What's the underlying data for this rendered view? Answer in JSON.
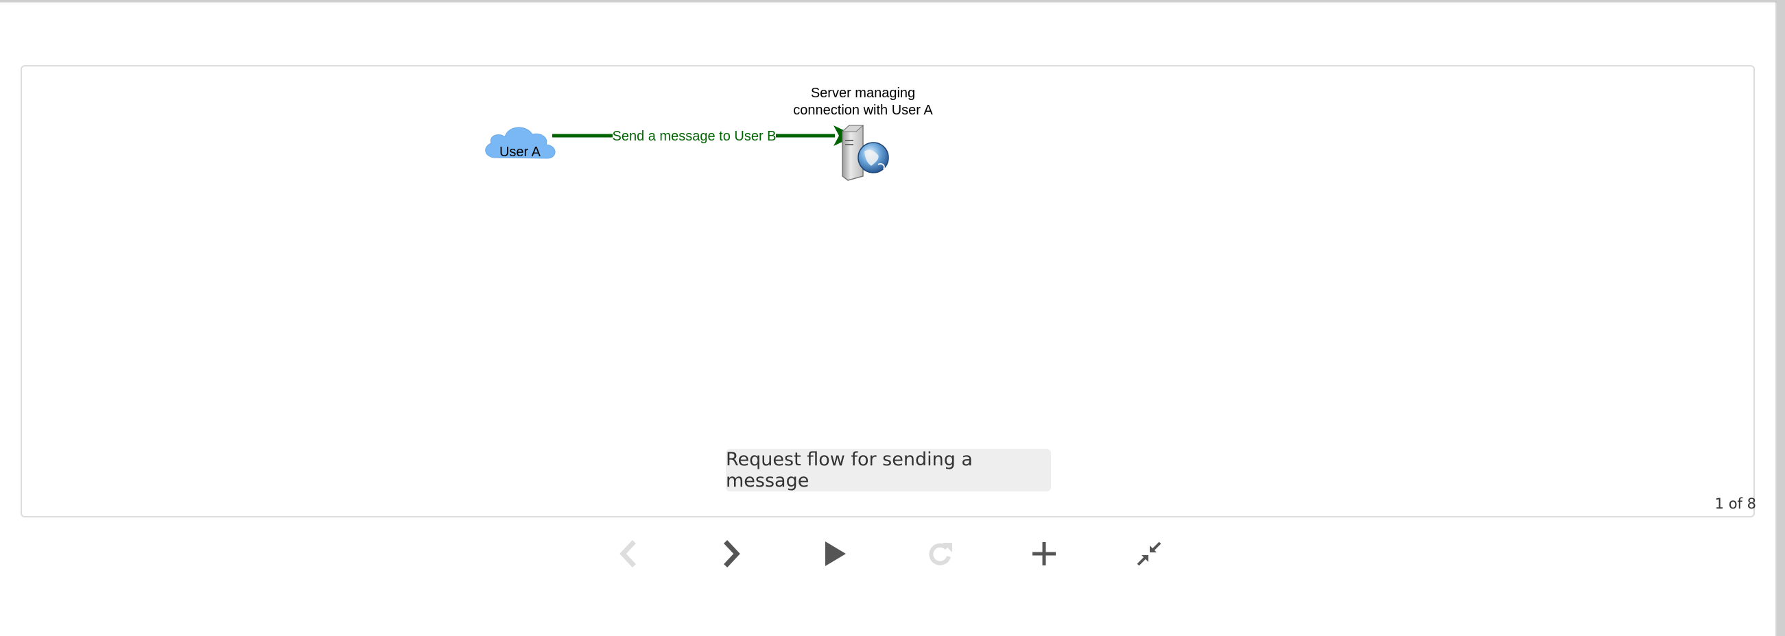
{
  "diagram": {
    "user_node_label": "User A",
    "edge_label": "Send a message to User B",
    "server_label_line1": "Server managing",
    "server_label_line2": "connection with User A",
    "edge_color": "#006400",
    "cloud_color": "#7ab8f5"
  },
  "caption": "Request flow for sending a message",
  "pagination": {
    "counter_text": "1 of 8"
  },
  "controls": [
    {
      "name": "previous-button",
      "icon": "chevron-left-icon",
      "enabled": false
    },
    {
      "name": "next-button",
      "icon": "chevron-right-icon",
      "enabled": true
    },
    {
      "name": "play-button",
      "icon": "play-icon",
      "enabled": true
    },
    {
      "name": "reload-button",
      "icon": "redo-icon",
      "enabled": false
    },
    {
      "name": "zoom-in-button",
      "icon": "plus-icon",
      "enabled": true
    },
    {
      "name": "collapse-button",
      "icon": "compress-icon",
      "enabled": true
    }
  ],
  "colors": {
    "icon_enabled": "#555555",
    "icon_disabled": "#dddddd",
    "caption_bg": "#eeeeee"
  }
}
